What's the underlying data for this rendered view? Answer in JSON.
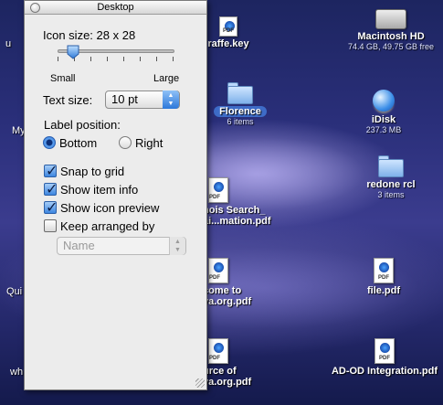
{
  "palette": {
    "title": "Desktop",
    "icon_size_label": "Icon size:",
    "icon_size_value": "28 x 28",
    "slider_small": "Small",
    "slider_large": "Large",
    "text_size_label": "Text size:",
    "text_size_value": "10 pt",
    "label_position_label": "Label position:",
    "label_bottom": "Bottom",
    "label_right": "Right",
    "label_position_selected": "Bottom",
    "snap_to_grid": {
      "label": "Snap to grid",
      "checked": true
    },
    "show_item_info": {
      "label": "Show item info",
      "checked": true
    },
    "show_icon_preview": {
      "label": "Show icon preview",
      "checked": true
    },
    "keep_arranged_by": {
      "label": "Keep arranged by",
      "checked": false
    },
    "arrange_select": "Name"
  },
  "desktop": {
    "icons": {
      "macintosh_hd": {
        "label": "Macintosh HD",
        "info": "74.4 GB, 49.75 GB free"
      },
      "idisk": {
        "label": "iDisk",
        "info": "237.3 MB"
      },
      "redone_rcl": {
        "label": "redone rcl",
        "info": "3 items"
      },
      "file_pdf": {
        "label": "file.pdf"
      },
      "ad_od": {
        "label": "AD-OD Integration.pdf"
      },
      "florence": {
        "label": "Florence",
        "info": "6 items"
      },
      "giraffe_key": {
        "label": "raffe.key"
      },
      "whois_l1": {
        "label": "hois Search_"
      },
      "whois_l2": {
        "label": "ai...mation.pdf"
      },
      "welcome_l1": {
        "label": "come to"
      },
      "welcome_l2": {
        "label": "ya.org.pdf"
      },
      "source_l1": {
        "label": "urce of"
      },
      "source_l2": {
        "label": "ya.org.pdf"
      }
    },
    "edge_fragments": {
      "u": "u",
      "my": "My",
      "qui": "Qui",
      "wh": "wh"
    }
  },
  "colors": {
    "selection": "#3e6cc8",
    "accent_blue": "#2d78da"
  }
}
